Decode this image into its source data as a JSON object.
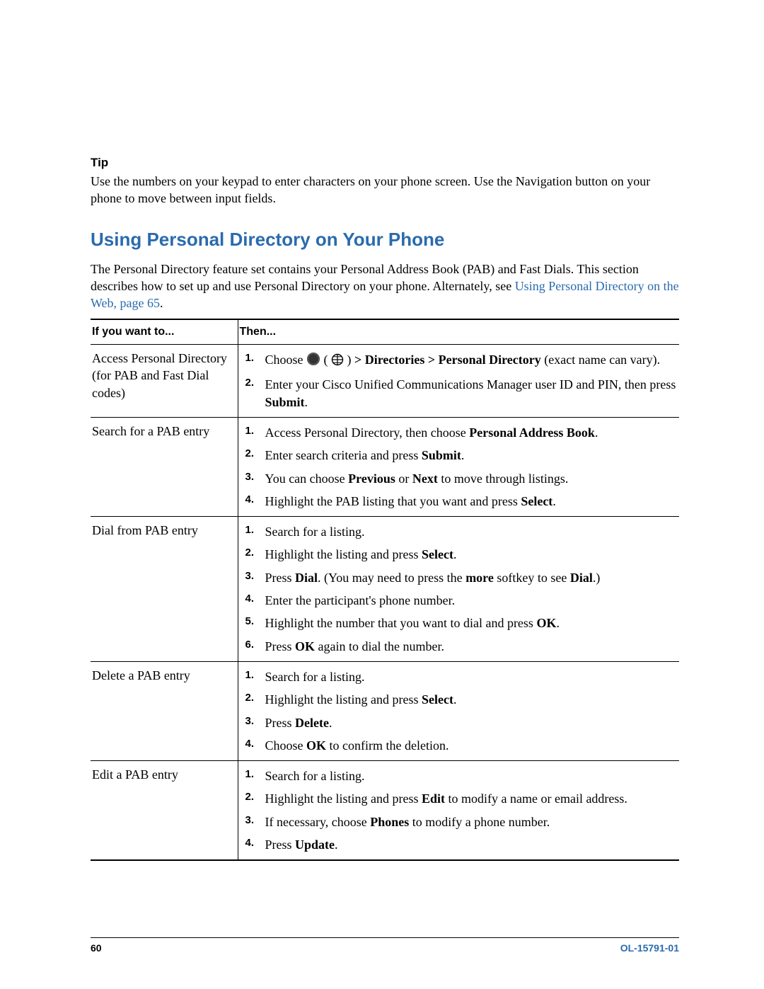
{
  "tip": {
    "heading": "Tip",
    "body": "Use the numbers on your keypad to enter characters on your phone screen. Use the Navigation button on your phone to move between input fields."
  },
  "section": {
    "heading": "Using Personal Directory on Your Phone",
    "intro_before_link": "The Personal Directory feature set contains your Personal Address Book (PAB) and Fast Dials. This section describes how to set up and use Personal Directory on your phone. Alternately, see ",
    "intro_link": "Using Personal Directory on the Web, page 65",
    "intro_after_link": "."
  },
  "table": {
    "header_left": "If you want to...",
    "header_right": "Then...",
    "rows": [
      {
        "left": "Access Personal Directory (for PAB and Fast Dial codes)",
        "steps": [
          {
            "num": "1.",
            "segments": [
              {
                "t": "Choose "
              },
              {
                "icon": "applications"
              },
              {
                "t": " ( "
              },
              {
                "icon": "app-button"
              },
              {
                "t": " ) "
              },
              {
                "t": "> Directories > Personal Directory",
                "b": true
              },
              {
                "t": " (exact name can vary)."
              }
            ]
          },
          {
            "num": "2.",
            "segments": [
              {
                "t": "Enter your Cisco Unified Communications Manager user ID and PIN, then press "
              },
              {
                "t": "Submit",
                "b": true
              },
              {
                "t": "."
              }
            ]
          }
        ]
      },
      {
        "left": "Search for a PAB entry",
        "steps": [
          {
            "num": "1.",
            "segments": [
              {
                "t": "Access Personal Directory, then choose "
              },
              {
                "t": "Personal Address Book",
                "b": true
              },
              {
                "t": "."
              }
            ]
          },
          {
            "num": "2.",
            "segments": [
              {
                "t": "Enter search criteria and press "
              },
              {
                "t": "Submit",
                "b": true
              },
              {
                "t": "."
              }
            ]
          },
          {
            "num": "3.",
            "segments": [
              {
                "t": "You can choose "
              },
              {
                "t": "Previous",
                "b": true
              },
              {
                "t": " or "
              },
              {
                "t": "Next",
                "b": true
              },
              {
                "t": " to move through listings."
              }
            ]
          },
          {
            "num": "4.",
            "segments": [
              {
                "t": "Highlight the PAB listing that you want and press "
              },
              {
                "t": "Select",
                "b": true
              },
              {
                "t": "."
              }
            ]
          }
        ]
      },
      {
        "left": "Dial from PAB entry",
        "steps": [
          {
            "num": "1.",
            "segments": [
              {
                "t": "Search for a listing."
              }
            ]
          },
          {
            "num": "2.",
            "segments": [
              {
                "t": "Highlight the listing and press "
              },
              {
                "t": "Select",
                "b": true
              },
              {
                "t": "."
              }
            ]
          },
          {
            "num": "3.",
            "segments": [
              {
                "t": "Press "
              },
              {
                "t": "Dial",
                "b": true
              },
              {
                "t": ". (You may need to press the "
              },
              {
                "t": "more",
                "b": true
              },
              {
                "t": " softkey to see "
              },
              {
                "t": "Dial",
                "b": true
              },
              {
                "t": ".)"
              }
            ]
          },
          {
            "num": "4.",
            "segments": [
              {
                "t": "Enter the participant's phone number."
              }
            ]
          },
          {
            "num": "5.",
            "segments": [
              {
                "t": "Highlight the number that you want to dial and press "
              },
              {
                "t": "OK",
                "b": true
              },
              {
                "t": "."
              }
            ]
          },
          {
            "num": "6.",
            "segments": [
              {
                "t": "Press "
              },
              {
                "t": "OK",
                "b": true
              },
              {
                "t": " again to dial the number."
              }
            ]
          }
        ]
      },
      {
        "left": "Delete a PAB entry",
        "steps": [
          {
            "num": "1.",
            "segments": [
              {
                "t": "Search for a listing."
              }
            ]
          },
          {
            "num": "2.",
            "segments": [
              {
                "t": "Highlight the listing and press "
              },
              {
                "t": "Select",
                "b": true
              },
              {
                "t": "."
              }
            ]
          },
          {
            "num": "3.",
            "segments": [
              {
                "t": "Press "
              },
              {
                "t": "Delete",
                "b": true
              },
              {
                "t": "."
              }
            ]
          },
          {
            "num": "4.",
            "segments": [
              {
                "t": "Choose "
              },
              {
                "t": "OK",
                "b": true
              },
              {
                "t": " to confirm the deletion."
              }
            ]
          }
        ]
      },
      {
        "left": "Edit a PAB entry",
        "steps": [
          {
            "num": "1.",
            "segments": [
              {
                "t": "Search for a listing."
              }
            ]
          },
          {
            "num": "2.",
            "segments": [
              {
                "t": "Highlight the listing and press "
              },
              {
                "t": "Edit",
                "b": true
              },
              {
                "t": " to modify a name or email address."
              }
            ]
          },
          {
            "num": "3.",
            "segments": [
              {
                "t": "If necessary, choose "
              },
              {
                "t": "Phones",
                "b": true
              },
              {
                "t": " to modify a phone number."
              }
            ]
          },
          {
            "num": "4.",
            "segments": [
              {
                "t": "Press "
              },
              {
                "t": "Update",
                "b": true
              },
              {
                "t": "."
              }
            ]
          }
        ]
      }
    ]
  },
  "footer": {
    "page_number": "60",
    "doc_id": "OL-15791-01"
  }
}
